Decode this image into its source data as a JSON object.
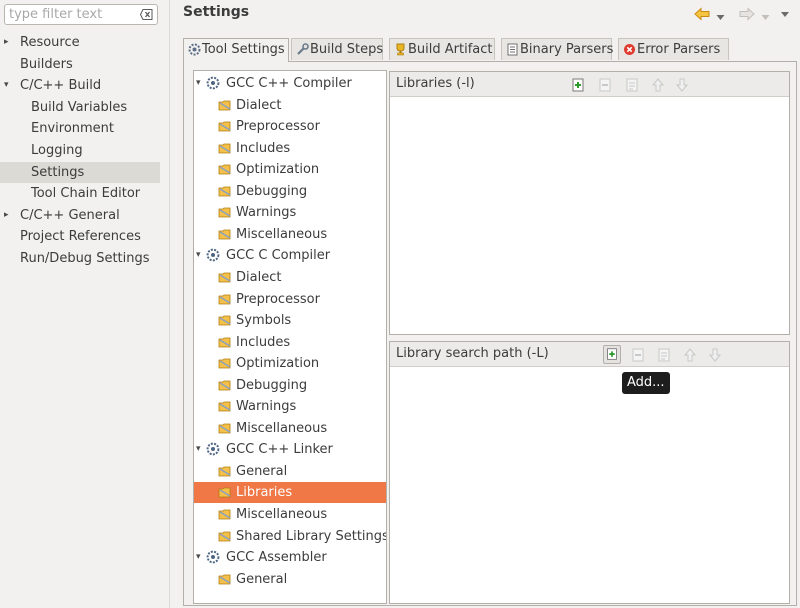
{
  "filter": {
    "placeholder": "type filter text"
  },
  "nav": {
    "items": [
      {
        "label": "Resource",
        "expander": "▸"
      },
      {
        "label": "Builders",
        "expander": ""
      },
      {
        "label": "C/C++ Build",
        "expander": "▾"
      },
      {
        "label": "Build Variables",
        "expander": ""
      },
      {
        "label": "Environment",
        "expander": ""
      },
      {
        "label": "Logging",
        "expander": ""
      },
      {
        "label": "Settings",
        "expander": ""
      },
      {
        "label": "Tool Chain Editor",
        "expander": ""
      },
      {
        "label": "C/C++ General",
        "expander": "▸"
      },
      {
        "label": "Project References",
        "expander": ""
      },
      {
        "label": "Run/Debug Settings",
        "expander": ""
      }
    ]
  },
  "header": {
    "title": "Settings"
  },
  "tabs": [
    {
      "label": "Tool Settings",
      "icon": "gear-icon"
    },
    {
      "label": "Build Steps",
      "icon": "wrench-icon"
    },
    {
      "label": "Build Artifact",
      "icon": "trophy-icon"
    },
    {
      "label": "Binary Parsers",
      "icon": "binary-icon"
    },
    {
      "label": "Error Parsers",
      "icon": "error-icon"
    }
  ],
  "tree": [
    {
      "label": "GCC C++ Compiler",
      "expander": "▾",
      "level": 0
    },
    {
      "label": "Dialect",
      "level": 1
    },
    {
      "label": "Preprocessor",
      "level": 1
    },
    {
      "label": "Includes",
      "level": 1
    },
    {
      "label": "Optimization",
      "level": 1
    },
    {
      "label": "Debugging",
      "level": 1
    },
    {
      "label": "Warnings",
      "level": 1
    },
    {
      "label": "Miscellaneous",
      "level": 1
    },
    {
      "label": "GCC C Compiler",
      "expander": "▾",
      "level": 0
    },
    {
      "label": "Dialect",
      "level": 1
    },
    {
      "label": "Preprocessor",
      "level": 1
    },
    {
      "label": "Symbols",
      "level": 1
    },
    {
      "label": "Includes",
      "level": 1
    },
    {
      "label": "Optimization",
      "level": 1
    },
    {
      "label": "Debugging",
      "level": 1
    },
    {
      "label": "Warnings",
      "level": 1
    },
    {
      "label": "Miscellaneous",
      "level": 1
    },
    {
      "label": "GCC C++ Linker",
      "expander": "▾",
      "level": 0
    },
    {
      "label": "General",
      "level": 1
    },
    {
      "label": "Libraries",
      "level": 1
    },
    {
      "label": "Miscellaneous",
      "level": 1
    },
    {
      "label": "Shared Library Settings",
      "level": 1
    },
    {
      "label": "GCC Assembler",
      "expander": "▾",
      "level": 0
    },
    {
      "label": "General",
      "level": 1
    }
  ],
  "libraries": {
    "title": "Libraries (-l)"
  },
  "library_paths": {
    "title": "Library search path (-L)"
  },
  "tooltip": {
    "text": "Add..."
  },
  "colors": {
    "selection": "#f07746",
    "nav_selection": "#dcdad5",
    "accent_arrow": "#e3a21a"
  }
}
